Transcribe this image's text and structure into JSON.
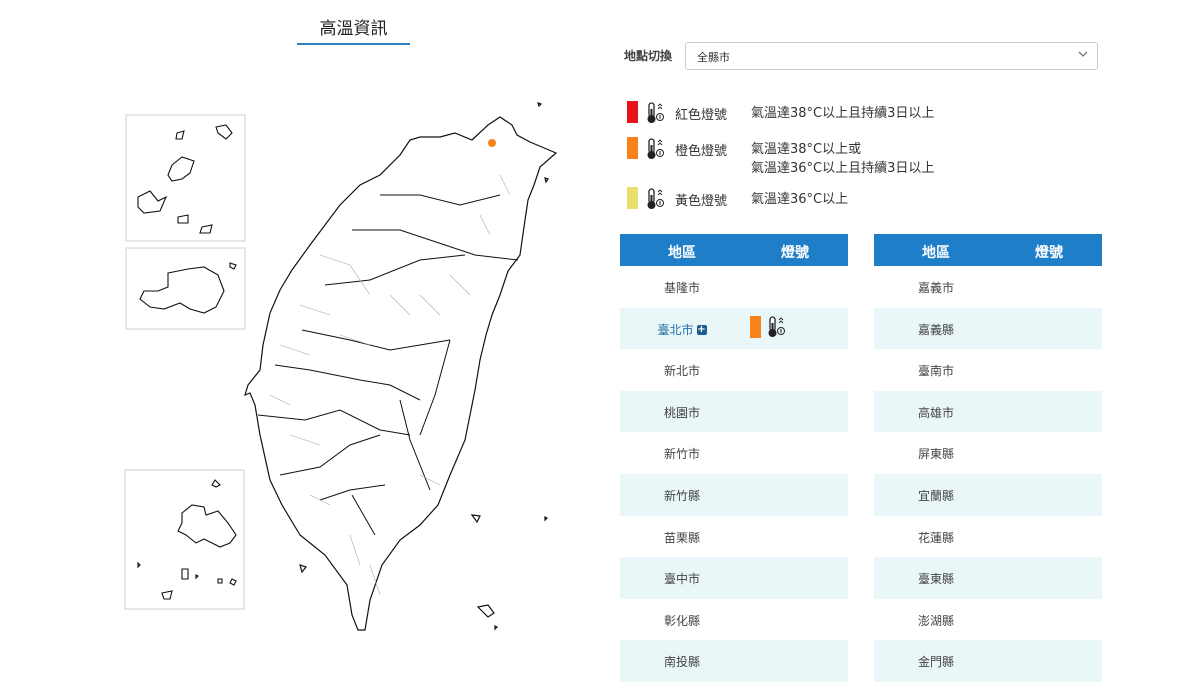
{
  "page": {
    "title": "高溫資訊"
  },
  "location": {
    "label": "地點切換",
    "selected": "全縣市"
  },
  "legend": [
    {
      "name": "紅色燈號",
      "color": "#e8141b",
      "desc1": "氣溫達38°C以上且持續3日以上",
      "desc2": "",
      "icon": "thermometer-icon"
    },
    {
      "name": "橙色燈號",
      "color": "#f7821b",
      "desc1": "氣溫達38°C以上或",
      "desc2": "氣溫達36°C以上且持續3日以上",
      "icon": "thermometer-icon"
    },
    {
      "name": "黃色燈號",
      "color": "#e8e06a",
      "desc1": "氣溫達36°C以上",
      "desc2": "",
      "icon": "thermometer-icon"
    }
  ],
  "table": {
    "col_region": "地區",
    "col_signal": "燈號",
    "left": [
      "基隆市",
      "臺北市",
      "新北市",
      "桃園市",
      "新竹市",
      "新竹縣",
      "苗栗縣",
      "臺中市",
      "彰化縣",
      "南投縣"
    ],
    "right": [
      "嘉義市",
      "嘉義縣",
      "臺南市",
      "高雄市",
      "屏東縣",
      "宜蘭縣",
      "花蓮縣",
      "臺東縣",
      "澎湖縣",
      "金門縣"
    ],
    "warning_region": "臺北市",
    "warning_color": "#f7821b",
    "plus_symbol": "+"
  },
  "colors": {
    "accent": "#1f7ec8",
    "row_alt": "#eaf7f9"
  }
}
